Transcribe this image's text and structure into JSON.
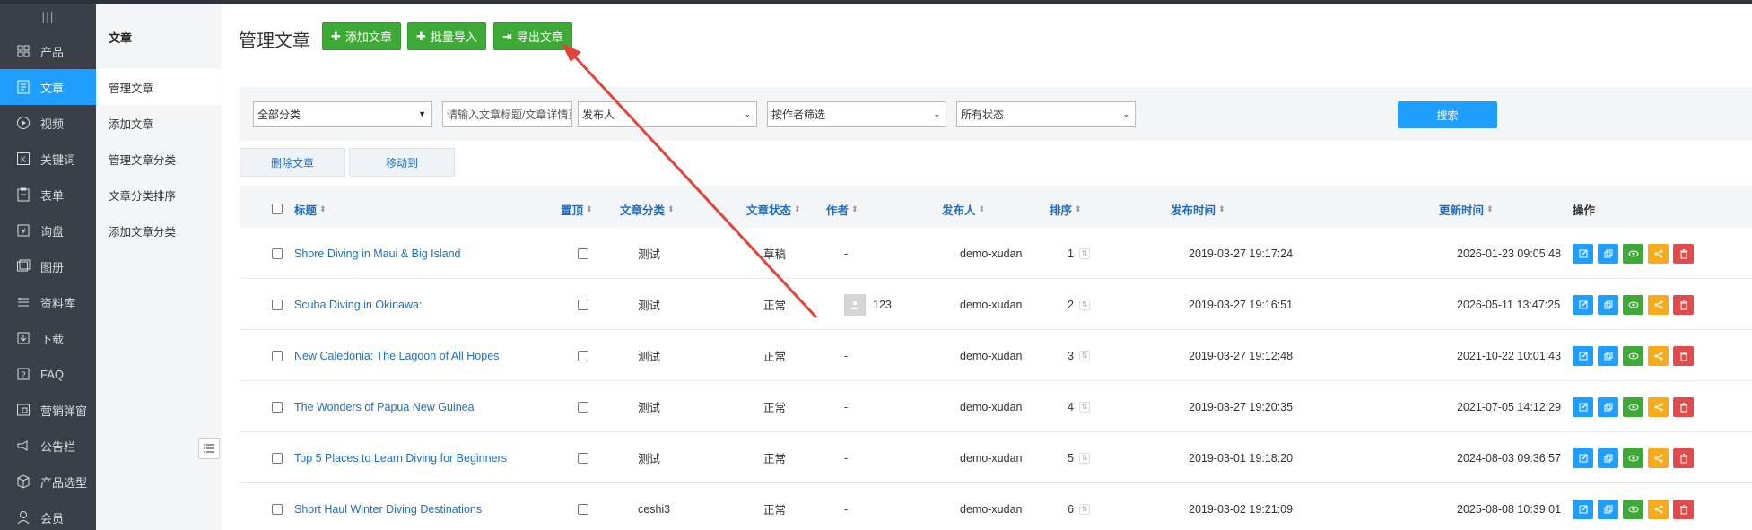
{
  "nav": {
    "items": [
      {
        "label": "产品",
        "icon": "grid-icon"
      },
      {
        "label": "文章",
        "icon": "document-icon",
        "active": true
      },
      {
        "label": "视频",
        "icon": "play-icon"
      },
      {
        "label": "关键词",
        "icon": "k-icon"
      },
      {
        "label": "表单",
        "icon": "clipboard-icon"
      },
      {
        "label": "询盘",
        "icon": "inquiry-icon"
      },
      {
        "label": "图册",
        "icon": "gallery-icon"
      },
      {
        "label": "资料库",
        "icon": "database-icon"
      },
      {
        "label": "下载",
        "icon": "download-icon"
      },
      {
        "label": "FAQ",
        "icon": "question-icon"
      },
      {
        "label": "营销弹窗",
        "icon": "popup-icon"
      },
      {
        "label": "公告栏",
        "icon": "megaphone-icon"
      },
      {
        "label": "产品选型",
        "icon": "cube-icon"
      },
      {
        "label": "会员",
        "icon": "user-icon"
      }
    ]
  },
  "sub": {
    "heading": "文章",
    "items": [
      {
        "label": "管理文章",
        "active": true
      },
      {
        "label": "添加文章"
      },
      {
        "label": "管理文章分类"
      },
      {
        "label": "文章分类排序"
      },
      {
        "label": "添加文章分类"
      }
    ]
  },
  "page": {
    "title": "管理文章",
    "toolbar": {
      "add": "添加文章",
      "import": "批量导入",
      "export": "导出文章"
    }
  },
  "filters": {
    "category": "全部分类",
    "keyword_placeholder": "请输入文章标题/文章详情页URL",
    "publisher": "发布人",
    "author": "按作者筛选",
    "status": "所有状态",
    "search": "搜索"
  },
  "actions": {
    "delete": "删除文章",
    "move": "移动到"
  },
  "table": {
    "headers": {
      "title": "标题",
      "pin": "置顶",
      "category": "文章分类",
      "status": "文章状态",
      "author": "作者",
      "publisher": "发布人",
      "order": "排序",
      "published": "发布时间",
      "updated": "更新时间",
      "ops": "操作"
    },
    "rows": [
      {
        "title": "Shore Diving in Maui & Big Island",
        "category": "测试",
        "status": "草稿",
        "author": "-",
        "publisher": "demo-xudan",
        "order": "1",
        "published": "2019-03-27 19:17:24",
        "updated": "2026-01-23 09:05:48"
      },
      {
        "title": "Scuba Diving in Okinawa:",
        "category": "测试",
        "status": "正常",
        "author": "123",
        "author_avatar": true,
        "publisher": "demo-xudan",
        "order": "2",
        "published": "2019-03-27 19:16:51",
        "updated": "2026-05-11 13:47:25"
      },
      {
        "title": "New Caledonia: The Lagoon of All Hopes",
        "category": "测试",
        "status": "正常",
        "author": "-",
        "publisher": "demo-xudan",
        "order": "3",
        "published": "2019-03-27 19:12:48",
        "updated": "2021-10-22 10:01:43"
      },
      {
        "title": "The Wonders of Papua New Guinea",
        "category": "测试",
        "status": "正常",
        "author": "-",
        "publisher": "demo-xudan",
        "order": "4",
        "published": "2019-03-27 19:20:35",
        "updated": "2021-07-05 14:12:29"
      },
      {
        "title": "Top 5 Places to Learn Diving for Beginners",
        "category": "测试",
        "status": "正常",
        "author": "-",
        "publisher": "demo-xudan",
        "order": "5",
        "published": "2019-03-01 19:18:20",
        "updated": "2024-08-03 09:36:57"
      },
      {
        "title": "Short Haul Winter Diving Destinations",
        "category": "ceshi3",
        "status": "正常",
        "author": "-",
        "publisher": "demo-xudan",
        "order": "6",
        "published": "2019-03-02 19:21:09",
        "updated": "2025-08-08 10:39:01"
      }
    ]
  },
  "colors": {
    "accent": "#1e9fff",
    "green": "#3da936",
    "orange": "#f7ab1a",
    "red": "#e14b4b",
    "sidebar": "#3b3f47",
    "annotation_arrow": "#e0443a"
  }
}
